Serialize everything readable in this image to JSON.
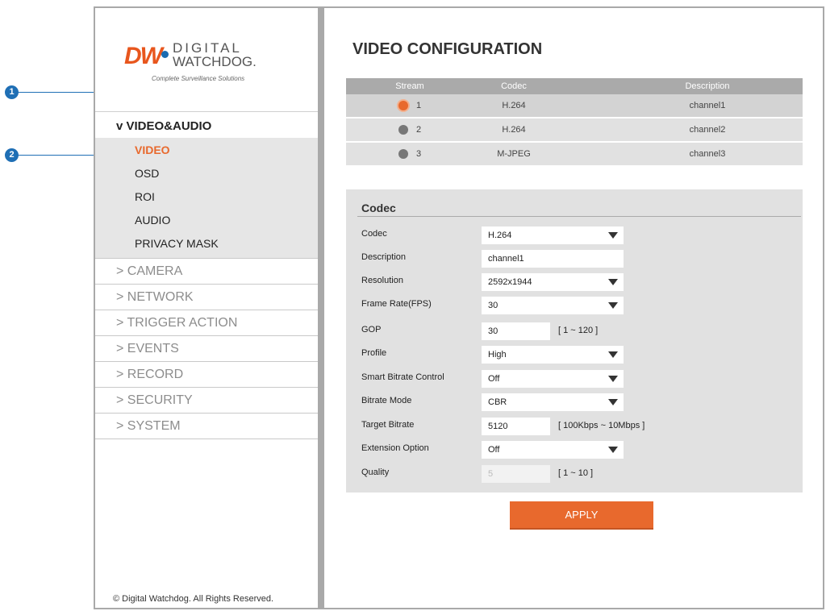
{
  "brand": {
    "logo_mark": "DW",
    "logo_line1": "DIGITAL",
    "logo_line2": "WATCHDOG.",
    "tagline": "Complete Surveillance Solutions"
  },
  "sidebar": {
    "section_title": "v VIDEO&AUDIO",
    "sub_items": [
      "VIDEO",
      "OSD",
      "ROI",
      "AUDIO",
      "PRIVACY MASK"
    ],
    "active_sub": "VIDEO",
    "categories": [
      "> CAMERA",
      "> NETWORK",
      "> TRIGGER ACTION",
      "> EVENTS",
      "> RECORD",
      "> SECURITY",
      "> SYSTEM"
    ],
    "footer": "© Digital Watchdog. All Rights Reserved."
  },
  "main": {
    "title": "VIDEO CONFIGURATION",
    "stream_table": {
      "headers": [
        "Stream",
        "Codec",
        "Description"
      ],
      "rows": [
        {
          "stream": "1",
          "codec": "H.264",
          "description": "channel1",
          "selected": true
        },
        {
          "stream": "2",
          "codec": "H.264",
          "description": "channel2",
          "selected": false
        },
        {
          "stream": "3",
          "codec": "M-JPEG",
          "description": "channel3",
          "selected": false
        }
      ]
    },
    "codec_section": {
      "title": "Codec",
      "fields": {
        "codec": {
          "label": "Codec",
          "value": "H.264"
        },
        "description": {
          "label": "Description",
          "value": "channel1"
        },
        "resolution": {
          "label": "Resolution",
          "value": "2592x1944"
        },
        "frame_rate": {
          "label": "Frame Rate(FPS)",
          "value": "30"
        },
        "gop": {
          "label": "GOP",
          "value": "30",
          "range": "[ 1 ~ 120 ]"
        },
        "profile": {
          "label": "Profile",
          "value": "High"
        },
        "smart_bitrate": {
          "label": "Smart Bitrate Control",
          "value": "Off"
        },
        "bitrate_mode": {
          "label": "Bitrate Mode",
          "value": "CBR"
        },
        "target_bitrate": {
          "label": "Target Bitrate",
          "value": "5120",
          "range": "[ 100Kbps ~ 10Mbps ]"
        },
        "extension_option": {
          "label": "Extension Option",
          "value": "Off"
        },
        "quality": {
          "label": "Quality",
          "value": "5",
          "range": "[ 1 ~ 10 ]"
        }
      }
    },
    "apply_label": "APPLY"
  },
  "callouts": [
    "1",
    "2"
  ],
  "colors": {
    "accent": "#e8692d",
    "callout": "#1f6fb5",
    "header_bg": "#aaaaaa"
  }
}
